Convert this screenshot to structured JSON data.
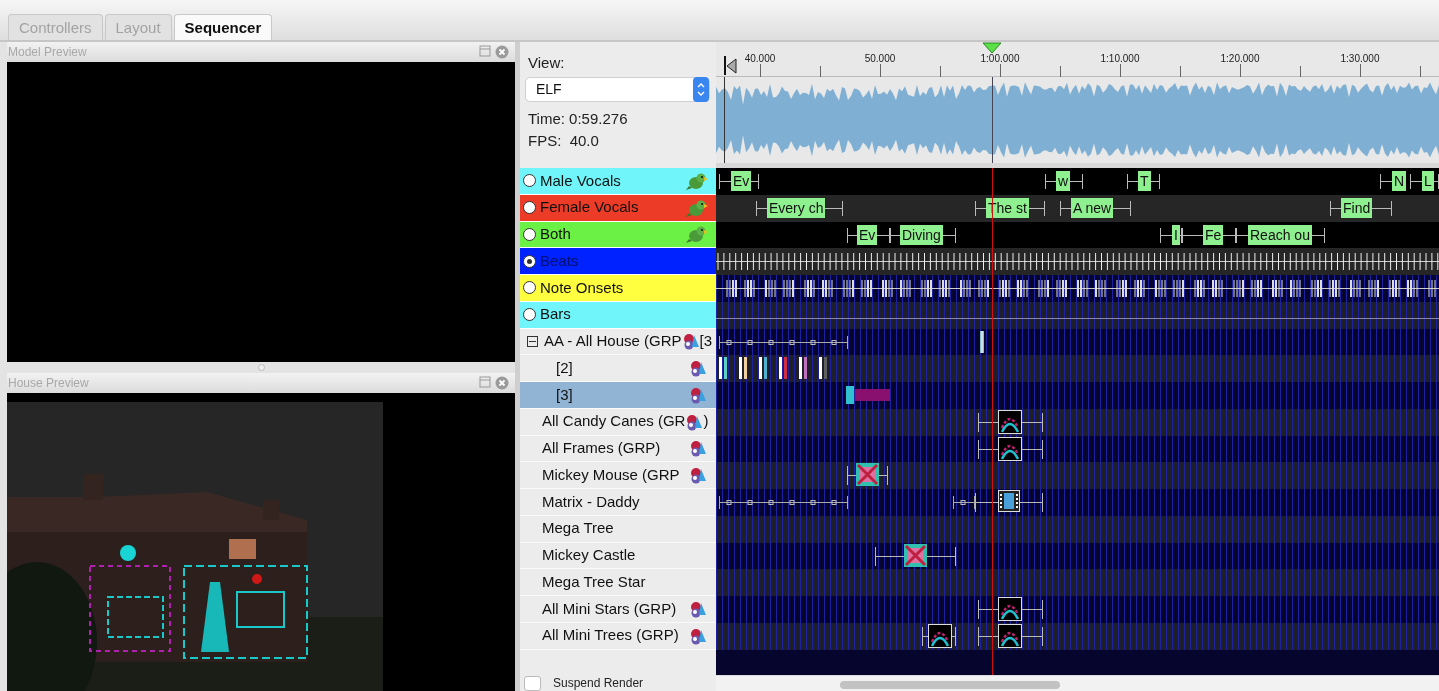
{
  "tabs": [
    {
      "label": "Controllers",
      "selected": false
    },
    {
      "label": "Layout",
      "selected": false
    },
    {
      "label": "Sequencer",
      "selected": true
    }
  ],
  "model_preview": {
    "title": "Model Preview"
  },
  "house_preview": {
    "title": "House Preview",
    "kind": "picture"
  },
  "sequencer": {
    "view_label": "View:",
    "view": "ELF",
    "time": "Time: 0:59.276",
    "fps": "FPS:  40.0",
    "ruler": [
      "40.000",
      "50.000",
      "1:00.000",
      "1:10.000",
      "1:20.000",
      "1:30.000"
    ],
    "timing_tracks": [
      {
        "name": "Male Vocals",
        "color": "#70f5fa",
        "selected": false,
        "kind": "labels",
        "marks": [
          "Ev",
          "w",
          "T",
          "N",
          "L"
        ]
      },
      {
        "name": "Female Vocals",
        "color": "#ec3b26",
        "selected": false,
        "kind": "labels",
        "marks": [
          "Every ch",
          "The st",
          "A new",
          "Find"
        ]
      },
      {
        "name": "Both",
        "color": "#6bf145",
        "selected": false,
        "kind": "labels",
        "marks": [
          "Ev",
          "Diving",
          "I",
          "Fe",
          "Reach ou"
        ]
      },
      {
        "name": "Beats",
        "color": "#0022ff",
        "selected": true,
        "kind": "beats"
      },
      {
        "name": "Note Onsets",
        "color": "#ffff40",
        "selected": false,
        "kind": "onsets"
      },
      {
        "name": "Bars",
        "color": "#70f5fa",
        "selected": false,
        "kind": "bars"
      }
    ],
    "model_rows": [
      {
        "name": "AA - All House (GRP",
        "suffix": "[3",
        "icon": true,
        "selected": false,
        "expanded": true,
        "effects": [
          {
            "kind": "dots"
          },
          {
            "kind": "marker"
          }
        ],
        "children": [
          {
            "name": "[2]",
            "icon": true,
            "selected": false,
            "effects": [
              {
                "kind": "bars"
              }
            ]
          },
          {
            "name": "[3]",
            "icon": true,
            "selected": true,
            "effects": [
              {
                "kind": "block"
              }
            ]
          }
        ]
      },
      {
        "name": "All Candy Canes (GR",
        "suffix": ")",
        "icon": true,
        "selected": false,
        "effects": [
          {
            "kind": "arc"
          }
        ]
      },
      {
        "name": "All Frames (GRP)",
        "icon": true,
        "selected": false,
        "effects": [
          {
            "kind": "arc"
          }
        ]
      },
      {
        "name": "Mickey Mouse (GRP",
        "icon": true,
        "selected": false,
        "effects": [
          {
            "kind": "cross"
          }
        ]
      },
      {
        "name": "Matrix - Daddy",
        "icon": false,
        "selected": false,
        "effects": [
          {
            "kind": "dots"
          },
          {
            "kind": "dots"
          },
          {
            "kind": "film"
          }
        ]
      },
      {
        "name": "Mega Tree",
        "icon": false,
        "selected": false
      },
      {
        "name": "Mickey Castle",
        "icon": false,
        "selected": false,
        "effects": [
          {
            "kind": "cross"
          }
        ]
      },
      {
        "name": "Mega Tree Star",
        "icon": false,
        "selected": false
      },
      {
        "name": "All Mini Stars (GRP)",
        "icon": true,
        "selected": false,
        "effects": [
          {
            "kind": "arc"
          }
        ]
      },
      {
        "name": "All Mini Trees (GRP)",
        "icon": true,
        "selected": false,
        "effects": [
          {
            "kind": "arc"
          },
          {
            "kind": "arc"
          }
        ]
      }
    ],
    "suspend_render": {
      "label": "Suspend Render",
      "checked": false
    }
  }
}
